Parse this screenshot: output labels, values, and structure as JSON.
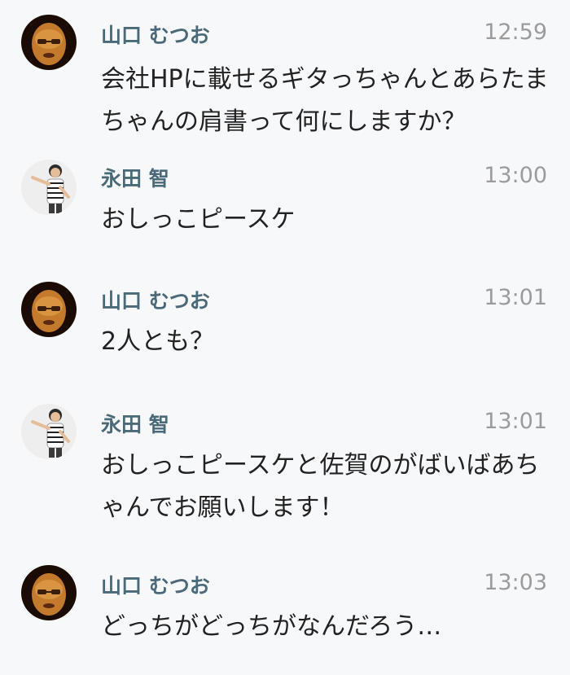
{
  "messages": [
    {
      "sender": "山口 むつお",
      "time": "12:59",
      "avatar": "yamaguchi-avatar",
      "text": "会社HPに載せるギタっちゃんとあらたまちゃんの肩書って何にしますか？"
    },
    {
      "sender": "永田 智",
      "time": "13:00",
      "avatar": "nagata-avatar",
      "text": "おしっこピースケ"
    },
    {
      "sender": "山口 むつお",
      "time": "13:01",
      "avatar": "yamaguchi-avatar",
      "text": "2人とも？"
    },
    {
      "sender": "永田 智",
      "time": "13:01",
      "avatar": "nagata-avatar",
      "text": "おしっこピースケと佐賀のがばいばあちゃんでお願いします！"
    },
    {
      "sender": "山口 むつお",
      "time": "13:03",
      "avatar": "yamaguchi-avatar",
      "text": "どっちがどっちがなんだろう…"
    }
  ],
  "colors": {
    "background": "#f7f8fa",
    "sender_name": "#4a6a7a",
    "timestamp": "#9b9b9b",
    "message_text": "#222222"
  }
}
